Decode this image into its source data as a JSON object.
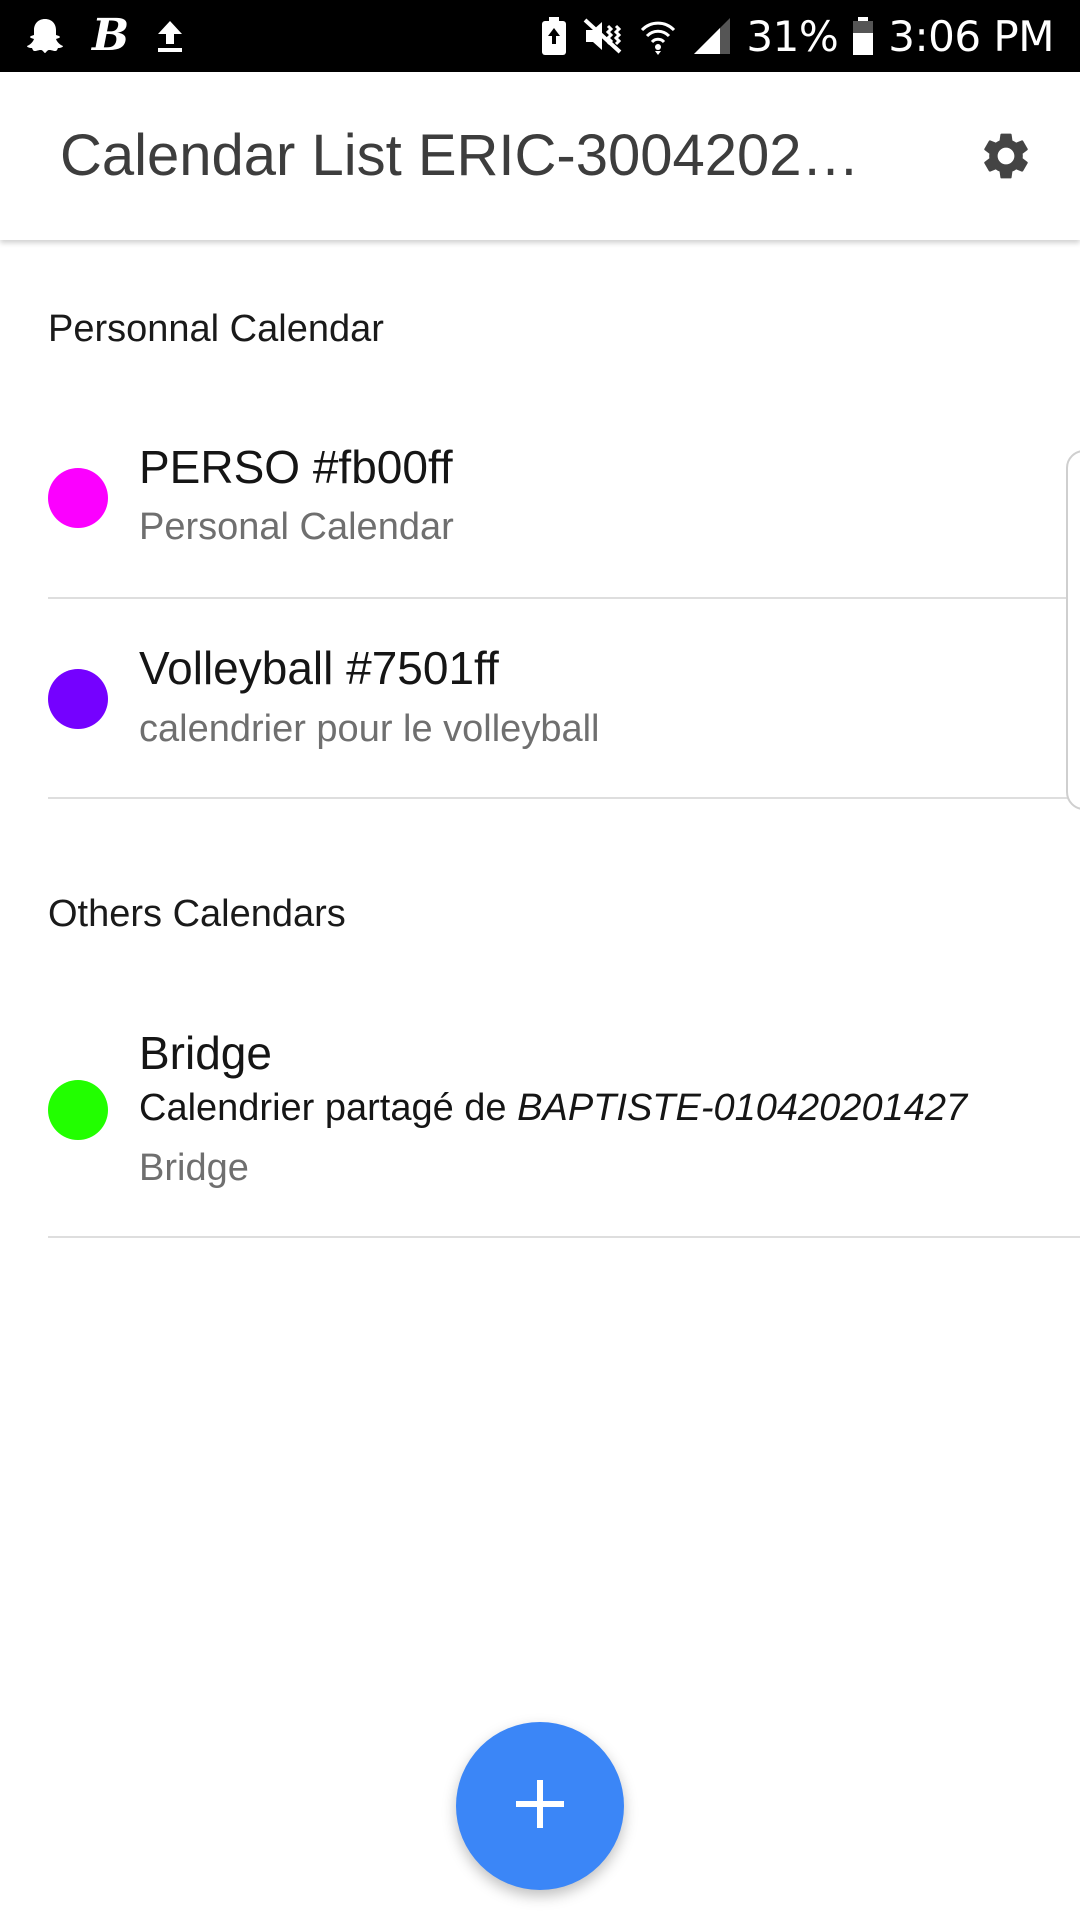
{
  "status_bar": {
    "battery_percent": "31%",
    "time": "3:06 PM",
    "left_icons": [
      "snapchat-icon",
      "b-app-icon",
      "upload-icon"
    ],
    "right_icons": [
      "battery-saver-icon",
      "mute-vibrate-icon",
      "wifi-icon",
      "signal-icon",
      "battery-icon"
    ],
    "b_letter": "B"
  },
  "app_bar": {
    "title": "Calendar List ERIC-3004202…",
    "settings_icon": "gear-icon"
  },
  "sections": {
    "personal": {
      "header": "Personnal Calendar",
      "items": [
        {
          "title": "PERSO #fb00ff",
          "subtitle": "Personal Calendar",
          "color": "#fb00ff"
        },
        {
          "title": "Volleyball #7501ff",
          "subtitle": "calendrier pour le volleyball",
          "color": "#7501ff"
        }
      ]
    },
    "others": {
      "header": "Others Calendars",
      "items": [
        {
          "title": "Bridge",
          "shared_prefix": "Calendrier partagé de ",
          "shared_owner": "BAPTISTE-010420201427",
          "subtitle": "Bridge",
          "color": "#22ff00"
        }
      ]
    }
  },
  "fab": {
    "icon": "plus-icon"
  }
}
